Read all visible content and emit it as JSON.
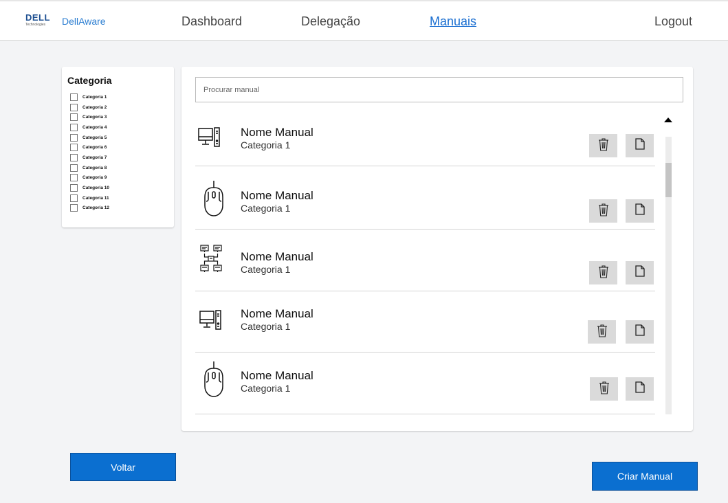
{
  "header": {
    "logo_text": "DELL",
    "logo_sub": "Technologies",
    "brand": "DellAware",
    "nav": [
      {
        "label": "Dashboard",
        "active": false
      },
      {
        "label": "Delegação",
        "active": false
      },
      {
        "label": "Manuais",
        "active": true
      }
    ],
    "logout": "Logout"
  },
  "sidebar": {
    "title": "Categoria",
    "categories": [
      "Categoria 1",
      "Categoria 2",
      "Categoria 3",
      "Categoria 4",
      "Categoria 5",
      "Categoria 6",
      "Categoria 7",
      "Categoria 8",
      "Categoria 9",
      "Categoria 10",
      "Categoria 11",
      "Categoria 12"
    ]
  },
  "search": {
    "placeholder": "Procurar manual",
    "value": ""
  },
  "manuals": [
    {
      "name": "Nome Manual",
      "category": "Categoria 1",
      "icon": "desktop-computer-icon"
    },
    {
      "name": "Nome Manual",
      "category": "Categoria 1",
      "icon": "mouse-icon"
    },
    {
      "name": "Nome Manual",
      "category": "Categoria 1",
      "icon": "network-icon"
    },
    {
      "name": "Nome Manual",
      "category": "Categoria 1",
      "icon": "desktop-computer-icon"
    },
    {
      "name": "Nome Manual",
      "category": "Categoria 1",
      "icon": "mouse-icon"
    }
  ],
  "row_actions": {
    "delete_icon": "trash-icon",
    "open_icon": "document-icon"
  },
  "footer": {
    "back_label": "Voltar",
    "create_label": "Criar Manual"
  },
  "colors": {
    "accent": "#0b6fd0",
    "nav_active": "#1b6fd1",
    "brand": "#2a7dd1"
  }
}
